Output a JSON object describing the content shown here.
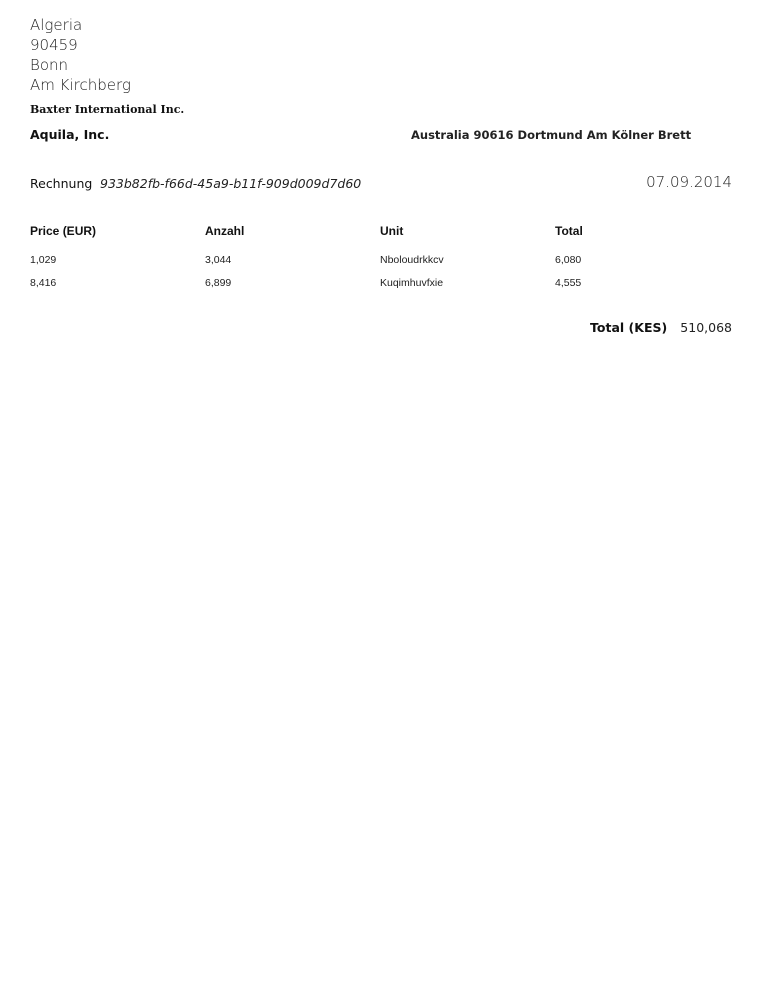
{
  "sender": {
    "address_lines": [
      "Algeria",
      "90459",
      "Bonn",
      "Am Kirchberg"
    ],
    "company": "Baxter International Inc."
  },
  "recipient": {
    "name": "Aquila, Inc.",
    "address": "Australia 90616 Dortmund Am Kölner Brett"
  },
  "invoice": {
    "label": "Rechnung",
    "number": "933b82fb-f66d-45a9-b11f-909d009d7d60",
    "date": "07.09.2014"
  },
  "table": {
    "headers": [
      "Price (EUR)",
      "Anzahl",
      "Unit",
      "Total"
    ],
    "rows": [
      [
        "1,029",
        "3,044",
        "Nboloudrkkcv",
        "6,080"
      ],
      [
        "8,416",
        "6,899",
        "Kuqimhuvfxie",
        "4,555"
      ]
    ]
  },
  "total": {
    "label": "Total (KES)",
    "value": "510,068"
  }
}
